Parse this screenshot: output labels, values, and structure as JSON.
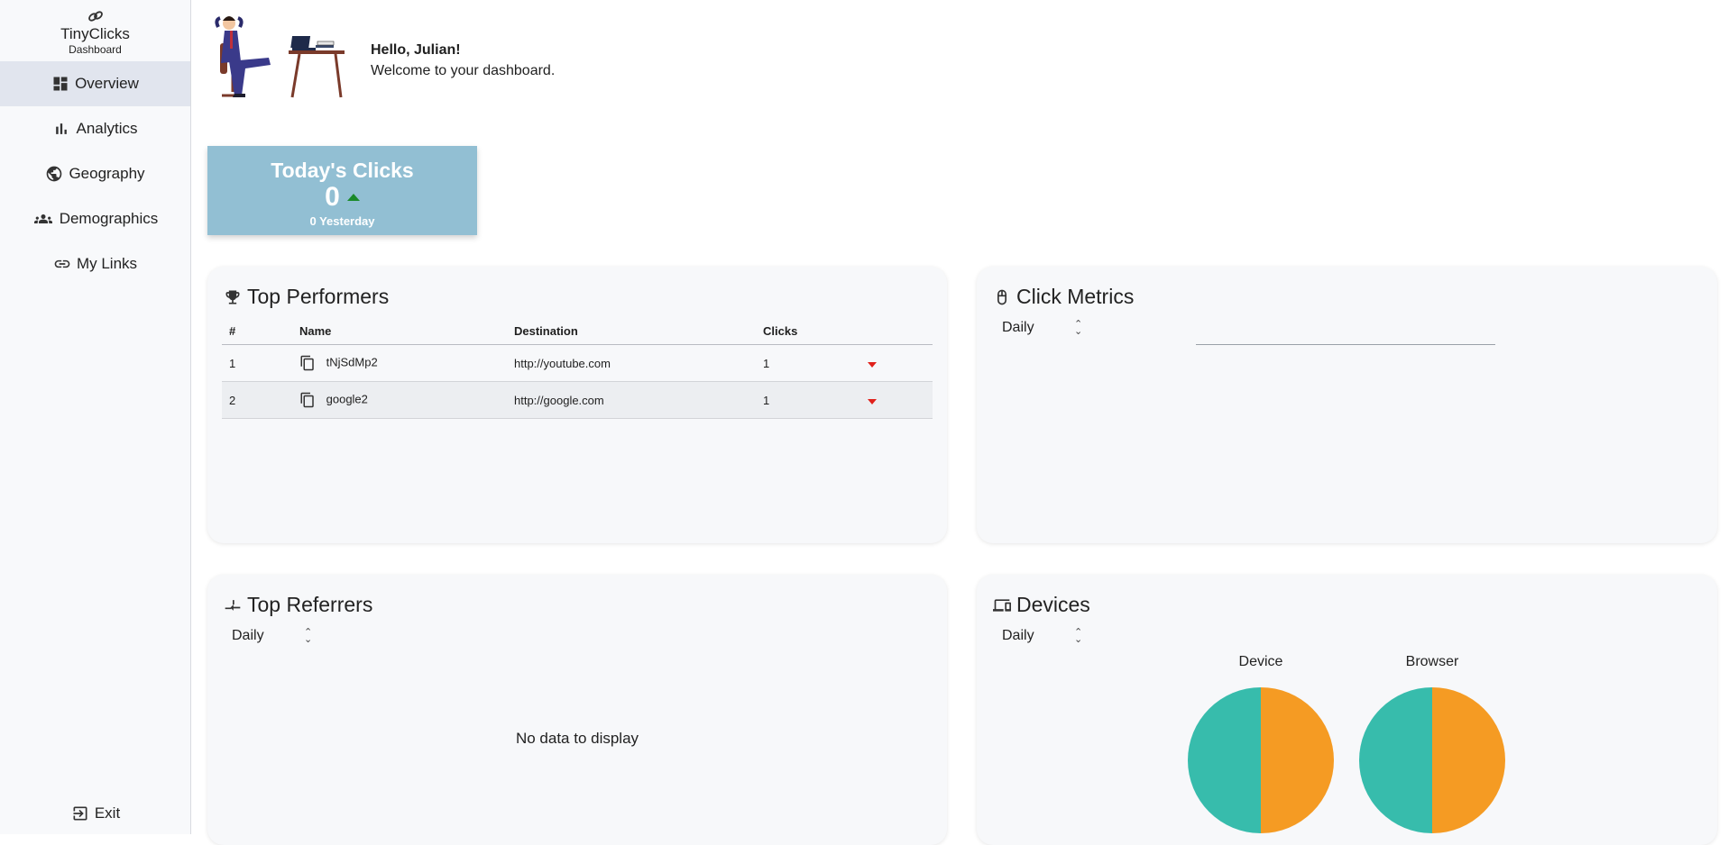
{
  "app": {
    "name": "TinyClicks",
    "subtitle": "Dashboard"
  },
  "sidebar": {
    "items": [
      {
        "label": "Overview",
        "icon": "dashboard-icon",
        "active": true
      },
      {
        "label": "Analytics",
        "icon": "bar-chart-icon"
      },
      {
        "label": "Geography",
        "icon": "globe-icon"
      },
      {
        "label": "Demographics",
        "icon": "groups-icon"
      },
      {
        "label": "My Links",
        "icon": "link-icon"
      }
    ],
    "exit_label": "Exit"
  },
  "greeting": {
    "title": "Hello, Julian!",
    "subtitle": "Welcome to your dashboard."
  },
  "todays_clicks": {
    "title": "Today's Clicks",
    "value": "0",
    "yesterday": "0 Yesterday",
    "trend": "up"
  },
  "top_performers": {
    "title": "Top Performers",
    "columns": [
      "#",
      "Name",
      "Destination",
      "Clicks"
    ],
    "rows": [
      {
        "rank": "1",
        "name": "tNjSdMp2",
        "destination": "http://youtube.com",
        "clicks": "1"
      },
      {
        "rank": "2",
        "name": "google2",
        "destination": "http://google.com",
        "clicks": "1"
      }
    ]
  },
  "click_metrics": {
    "title": "Click Metrics",
    "period": "Daily"
  },
  "top_referrers": {
    "title": "Top Referrers",
    "period": "Daily",
    "empty": "No data to display"
  },
  "devices": {
    "title": "Devices",
    "period": "Daily",
    "charts": [
      {
        "title": "Device"
      },
      {
        "title": "Browser"
      }
    ]
  },
  "chart_data": [
    {
      "type": "pie",
      "title": "Device",
      "values": [
        50,
        50
      ],
      "colors": [
        "#f59b23",
        "#37bcac"
      ]
    },
    {
      "type": "pie",
      "title": "Browser",
      "values": [
        50,
        50
      ],
      "colors": [
        "#f59b23",
        "#37bcac"
      ]
    }
  ],
  "colors": {
    "card": "#92bfd3",
    "trend_up": "#1a8a2a",
    "trend_down": "#e0211b",
    "pie_a": "#f59b23",
    "pie_b": "#37bcac"
  }
}
